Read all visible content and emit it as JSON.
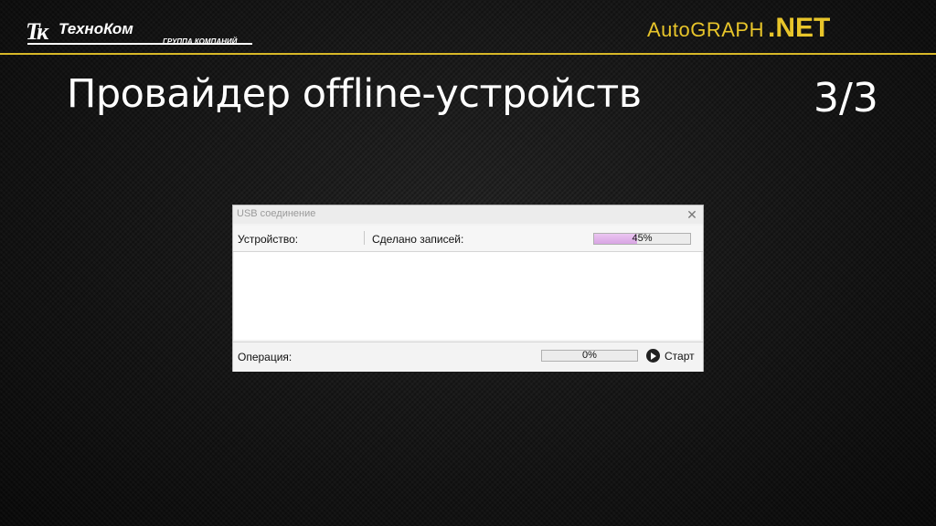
{
  "header": {
    "brand_mark": "Тк",
    "brand_name": "ТехноКом",
    "brand_sub": "ГРУППА КОМПАНИЙ",
    "product_prefix": "AutoGRAPH",
    "product_suffix": ".NET",
    "accent_color": "#d8b828"
  },
  "slide": {
    "title": "Провайдер offline-устройств",
    "page": "3/3"
  },
  "dialog": {
    "title": "USB соединение",
    "close_icon": "close-icon",
    "device_label": "Устройство:",
    "records_label": "Сделано записей:",
    "records_progress": {
      "percent": 45,
      "text": "45%",
      "color": "#dcaee6"
    },
    "operation_label": "Операция:",
    "operation_progress": {
      "percent": 0,
      "text": "0%"
    },
    "start_label": "Старт",
    "start_icon": "play-circle-icon"
  }
}
